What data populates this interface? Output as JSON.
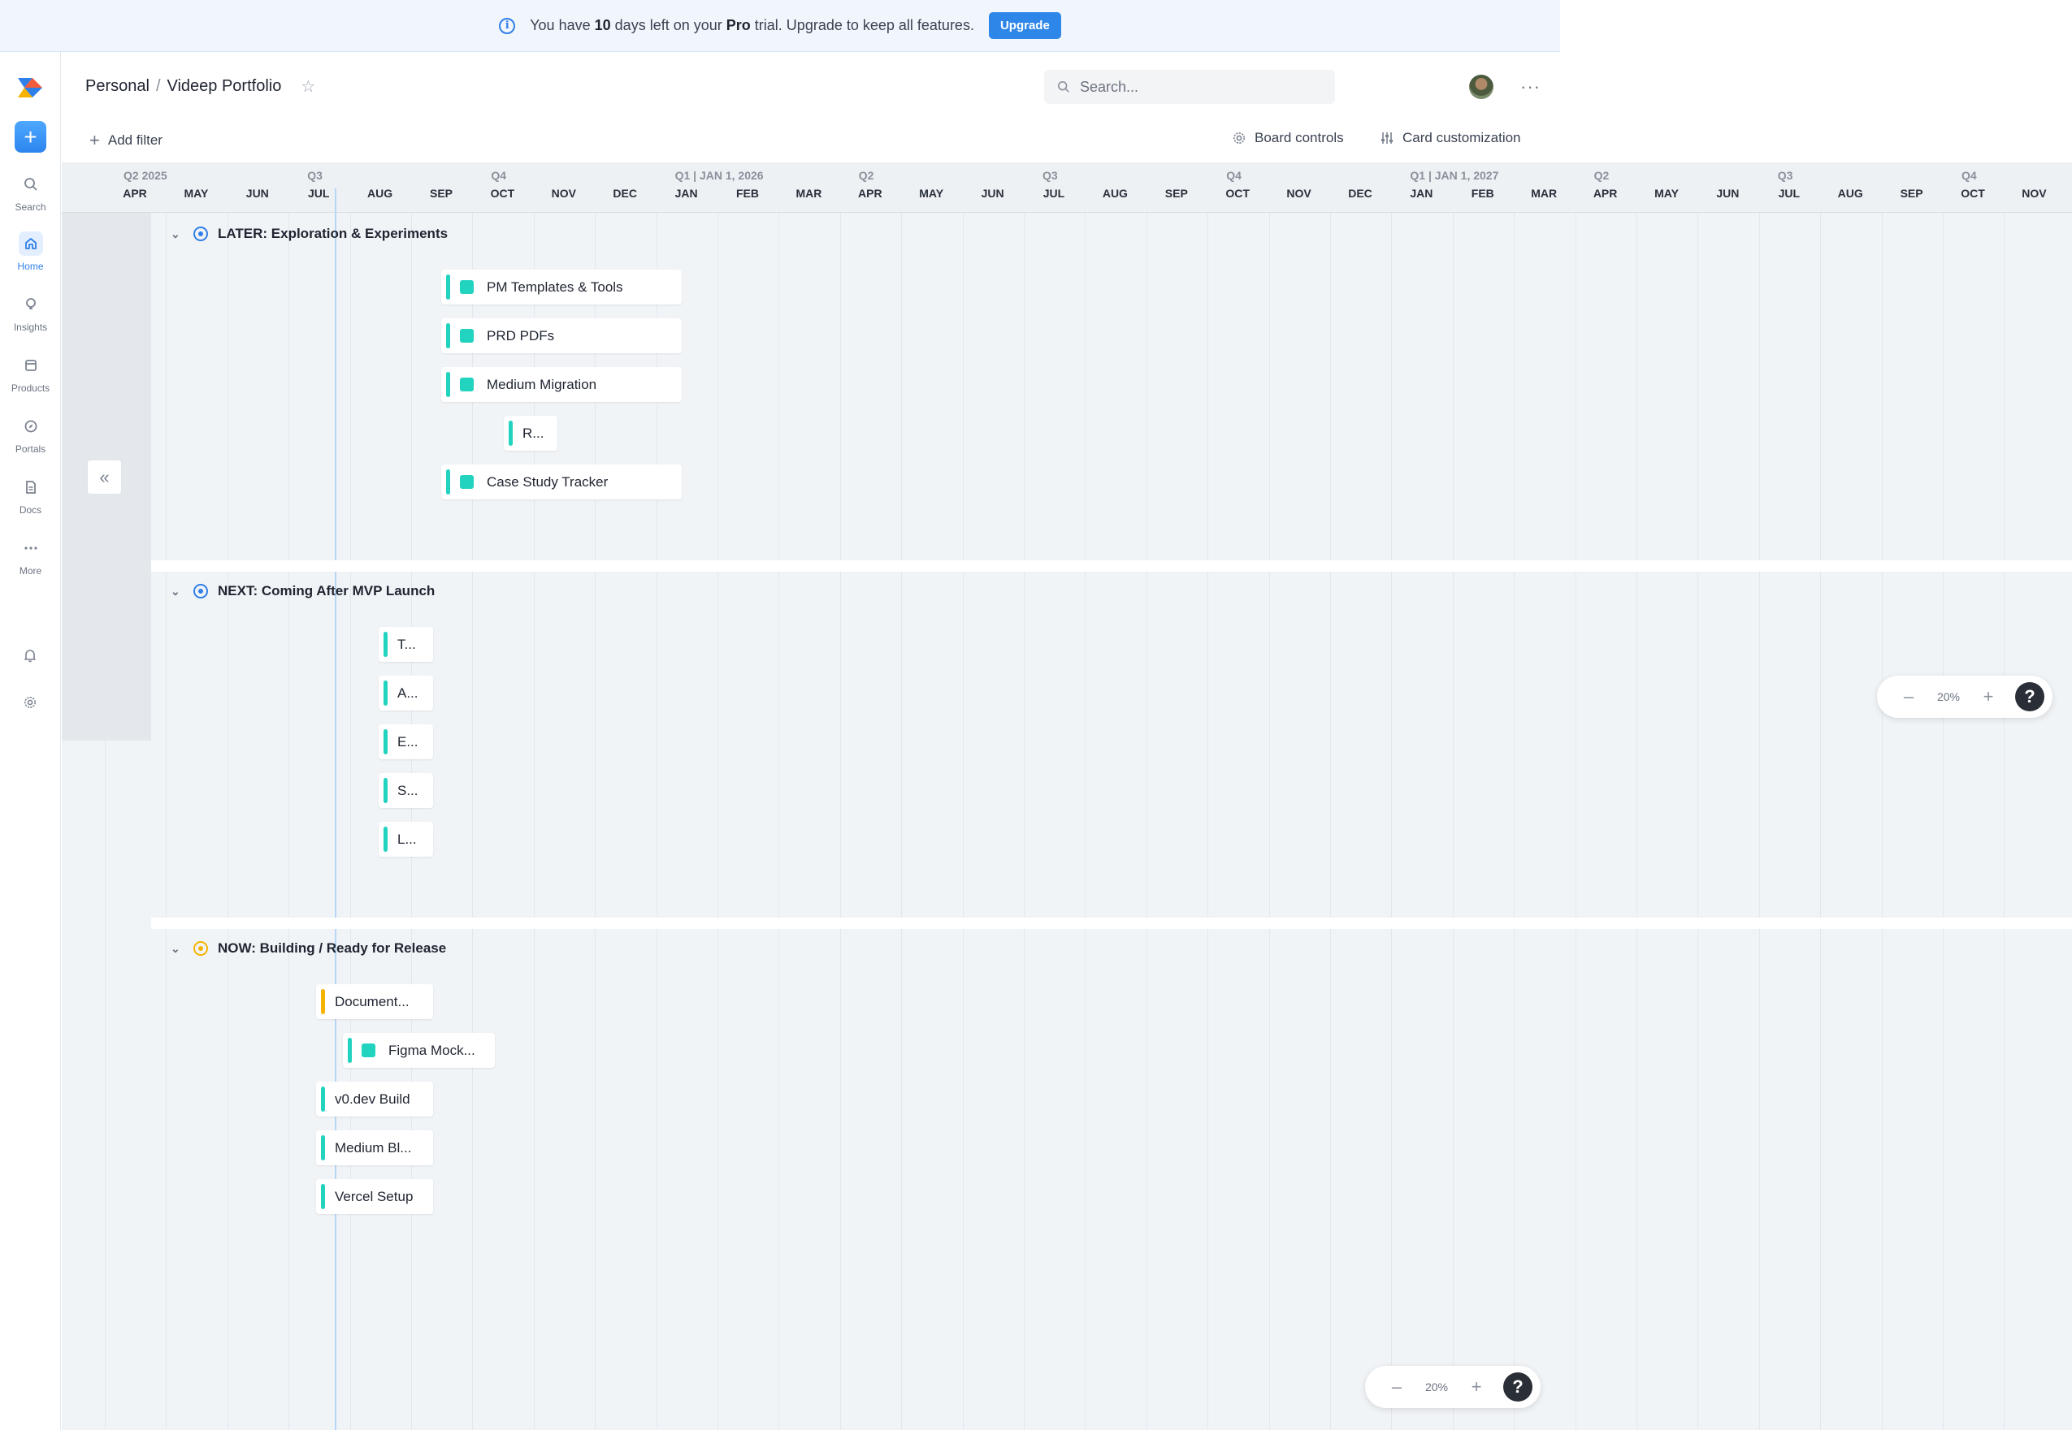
{
  "banner": {
    "prefix": "You have",
    "days": "10",
    "middle": "days left on your",
    "plan": "Pro",
    "suffix": "trial. Upgrade to keep all features.",
    "upgrade_label": "Upgrade"
  },
  "rail": {
    "items": [
      {
        "label": "Search",
        "icon": "search-icon"
      },
      {
        "label": "Home",
        "icon": "home-icon"
      },
      {
        "label": "Insights",
        "icon": "lightbulb-icon"
      },
      {
        "label": "Products",
        "icon": "box-icon"
      },
      {
        "label": "Portals",
        "icon": "compass-icon"
      },
      {
        "label": "Docs",
        "icon": "doc-icon"
      },
      {
        "label": "More",
        "icon": "more-icon"
      }
    ],
    "active": "Home"
  },
  "header": {
    "breadcrumb_parent": "Personal",
    "breadcrumb_sep": "/",
    "breadcrumb_title": "Videep Portfolio",
    "search_placeholder": "Search...",
    "add_filter": "Add filter",
    "board_controls": "Board controls",
    "card_customization": "Card customization"
  },
  "timeline": {
    "quarters": [
      "Q2 2025",
      "Q3",
      "Q4",
      "Q1 | JAN 1, 2026",
      "Q2",
      "Q3",
      "Q4",
      "Q1 | JAN 1, 2027",
      "Q2",
      "Q3",
      "Q4"
    ],
    "months": [
      "APR",
      "MAY",
      "JUN",
      "JUL",
      "AUG",
      "SEP",
      "OCT",
      "NOV",
      "DEC",
      "JAN",
      "FEB",
      "MAR",
      "APR",
      "MAY",
      "JUN",
      "JUL",
      "AUG",
      "SEP",
      "OCT",
      "NOV",
      "DEC",
      "JAN",
      "FEB",
      "MAR",
      "APR",
      "MAY",
      "JUN",
      "JUL",
      "AUG",
      "SEP",
      "OCT",
      "NOV"
    ]
  },
  "sections": [
    {
      "title": "LATER: Exploration & Experiments",
      "status_color": "#2f7fe9",
      "cards": [
        {
          "label": "PM Templates & Tools",
          "bar_color": "#22d3c0",
          "has_square": true
        },
        {
          "label": "PRD PDFs",
          "bar_color": "#22d3c0",
          "has_square": true
        },
        {
          "label": "Medium Migration",
          "bar_color": "#22d3c0",
          "has_square": true
        },
        {
          "label": "R...",
          "bar_color": "#22d3c0",
          "has_square": false
        },
        {
          "label": "Case Study Tracker",
          "bar_color": "#22d3c0",
          "has_square": true
        }
      ]
    },
    {
      "title": "NEXT: Coming After MVP Launch",
      "status_color": "#2f7fe9",
      "cards": [
        {
          "label": "T...",
          "bar_color": "#22d3c0",
          "has_square": false
        },
        {
          "label": "A...",
          "bar_color": "#22d3c0",
          "has_square": false
        },
        {
          "label": "E...",
          "bar_color": "#22d3c0",
          "has_square": false
        },
        {
          "label": "S...",
          "bar_color": "#22d3c0",
          "has_square": false
        },
        {
          "label": "L...",
          "bar_color": "#22d3c0",
          "has_square": false
        }
      ]
    },
    {
      "title": "NOW: Building / Ready for Release",
      "status_color": "#f5b300",
      "cards": [
        {
          "label": "Document...",
          "bar_color": "#f5b300",
          "has_square": false
        },
        {
          "label": "Figma Mock...",
          "bar_color": "#22d3c0",
          "has_square": true
        },
        {
          "label": "v0.dev Build",
          "bar_color": "#22d3c0",
          "has_square": false
        },
        {
          "label": "Medium Bl...",
          "bar_color": "#22d3c0",
          "has_square": false
        },
        {
          "label": "Vercel Setup",
          "bar_color": "#22d3c0",
          "has_square": false
        }
      ]
    }
  ],
  "zoom": {
    "value": "20%",
    "help": "?"
  },
  "colors": {
    "accent": "#2f86e9",
    "teal": "#22d3c0",
    "yellow": "#f5b300"
  }
}
